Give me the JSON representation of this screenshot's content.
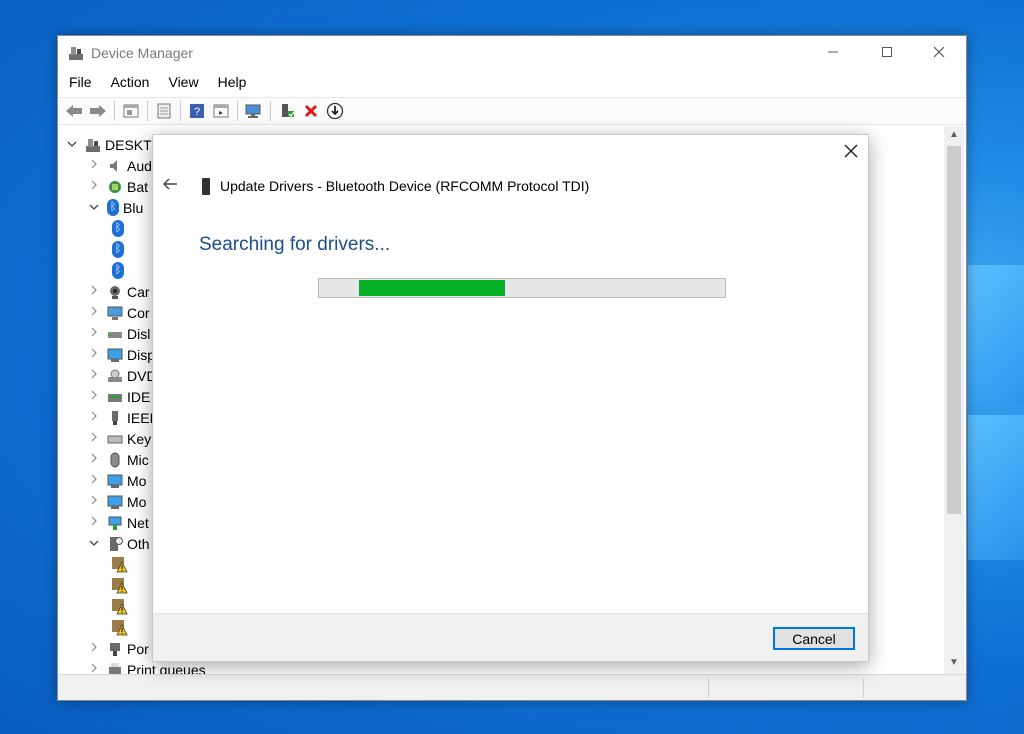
{
  "window": {
    "title": "Device Manager"
  },
  "menu": [
    "File",
    "Action",
    "View",
    "Help"
  ],
  "tree": {
    "root_label": "DESKTO",
    "items": [
      {
        "label": "Aud",
        "icon": "speaker-icon",
        "chev": ">"
      },
      {
        "label": "Bat",
        "icon": "battery-icon",
        "chev": ">"
      },
      {
        "label": "Blu",
        "icon": "bluetooth-icon",
        "chev": "v"
      },
      {
        "label": "",
        "icon": "bluetooth-device-icon",
        "chev": ""
      },
      {
        "label": "",
        "icon": "bluetooth-device-icon",
        "chev": ""
      },
      {
        "label": "",
        "icon": "bluetooth-device-icon",
        "chev": ""
      },
      {
        "label": "Car",
        "icon": "camera-icon",
        "chev": ">"
      },
      {
        "label": "Cor",
        "icon": "computer-icon",
        "chev": ">"
      },
      {
        "label": "Disl",
        "icon": "disk-icon",
        "chev": ">"
      },
      {
        "label": "Disp",
        "icon": "display-icon",
        "chev": ">"
      },
      {
        "label": "DVD",
        "icon": "dvd-icon",
        "chev": ">"
      },
      {
        "label": "IDE",
        "icon": "ide-icon",
        "chev": ">"
      },
      {
        "label": "IEEE",
        "icon": "ieee-icon",
        "chev": ">"
      },
      {
        "label": "Key",
        "icon": "keyboard-icon",
        "chev": ">"
      },
      {
        "label": "Mic",
        "icon": "mouse-icon",
        "chev": ">"
      },
      {
        "label": "Mo",
        "icon": "monitor-icon",
        "chev": ">"
      },
      {
        "label": "Mo",
        "icon": "monitor-icon",
        "chev": ">"
      },
      {
        "label": "Net",
        "icon": "network-icon",
        "chev": ">"
      },
      {
        "label": "Oth",
        "icon": "other-devices-icon",
        "chev": "v"
      },
      {
        "label": "",
        "icon": "warning-device-icon",
        "chev": ""
      },
      {
        "label": "",
        "icon": "warning-device-icon",
        "chev": ""
      },
      {
        "label": "",
        "icon": "warning-device-icon",
        "chev": ""
      },
      {
        "label": "",
        "icon": "warning-device-icon",
        "chev": ""
      },
      {
        "label": "Por",
        "icon": "port-icon",
        "chev": ">"
      },
      {
        "label": "Print queues",
        "icon": "printer-icon",
        "chev": ">"
      }
    ]
  },
  "dialog": {
    "title": "Update Drivers - Bluetooth Device (RFCOMM Protocol TDI)",
    "heading": "Searching for drivers...",
    "progress_fraction": 0.36,
    "cancel_label": "Cancel"
  },
  "colors": {
    "progress": "#06b025",
    "heading": "#1b4f8a",
    "accent": "#0078d7"
  }
}
